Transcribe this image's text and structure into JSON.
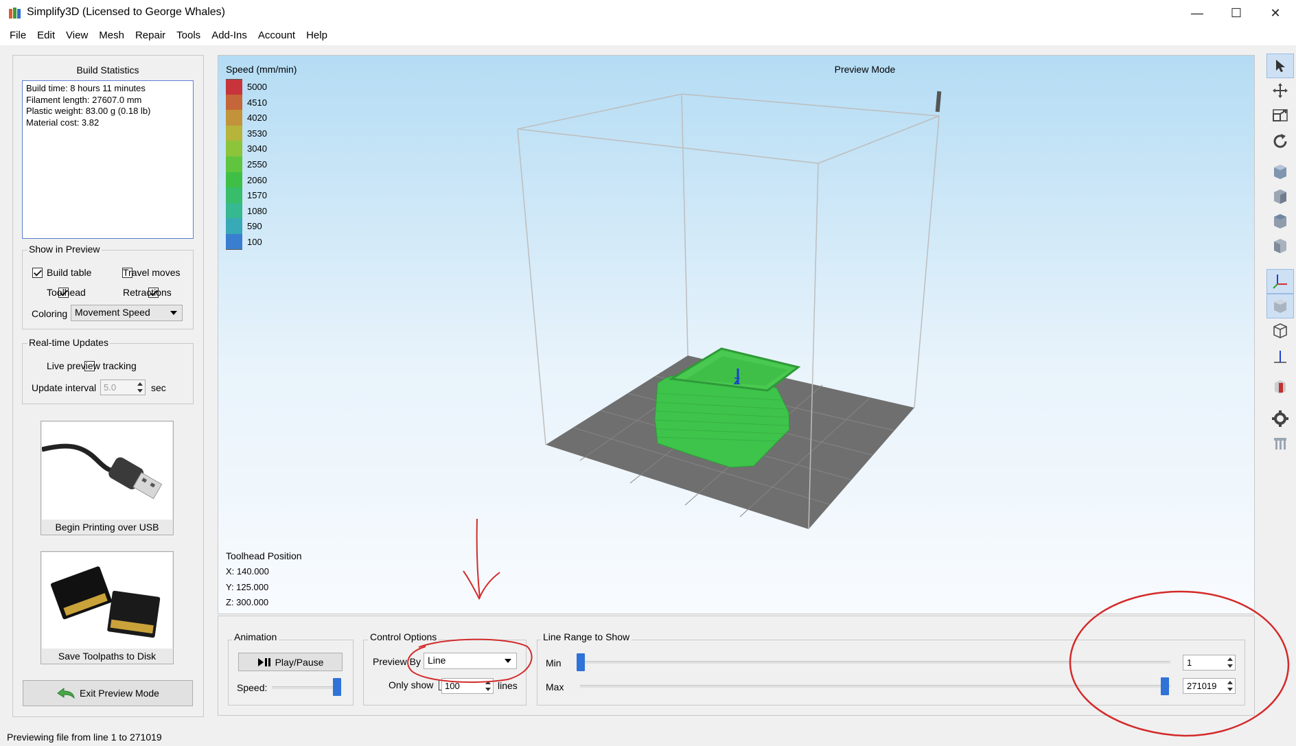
{
  "window": {
    "title": "Simplify3D (Licensed to George Whales)",
    "minimize_glyph": "—",
    "maximize_glyph": "☐",
    "close_glyph": "✕"
  },
  "menu": [
    "File",
    "Edit",
    "View",
    "Mesh",
    "Repair",
    "Tools",
    "Add-Ins",
    "Account",
    "Help"
  ],
  "build_statistics": {
    "title": "Build Statistics",
    "lines": [
      "Build time: 8 hours 11 minutes",
      "Filament length: 27607.0 mm",
      "Plastic weight: 83.00 g (0.18 lb)",
      "Material cost: 3.82"
    ]
  },
  "show_in_preview": {
    "title": "Show in Preview",
    "build_table": {
      "label": "Build table",
      "checked": true
    },
    "travel_moves": {
      "label": "Travel moves",
      "checked": false
    },
    "toolhead": {
      "label": "Toolhead",
      "checked": true
    },
    "retractions": {
      "label": "Retractions",
      "checked": true
    },
    "coloring_label": "Coloring",
    "coloring_value": "Movement Speed"
  },
  "realtime_updates": {
    "title": "Real-time Updates",
    "live_preview": {
      "label": "Live preview tracking",
      "checked": false
    },
    "update_interval_label": "Update interval",
    "update_interval_value": "5.0",
    "unit": "sec"
  },
  "actions": {
    "usb_label": "Begin Printing over USB",
    "disk_label": "Save Toolpaths to Disk",
    "exit_label": "Exit Preview Mode"
  },
  "viewport": {
    "mode_label": "Preview Mode",
    "legend_title": "Speed (mm/min)",
    "legend": [
      {
        "value": "5000",
        "color": "#c8343c"
      },
      {
        "value": "4510",
        "color": "#c4663a"
      },
      {
        "value": "4020",
        "color": "#c3933b"
      },
      {
        "value": "3530",
        "color": "#b6b43a"
      },
      {
        "value": "3040",
        "color": "#8cc43c"
      },
      {
        "value": "2550",
        "color": "#5fc53e"
      },
      {
        "value": "2060",
        "color": "#3fbf45"
      },
      {
        "value": "1570",
        "color": "#38bd6a"
      },
      {
        "value": "1080",
        "color": "#36b890"
      },
      {
        "value": "590",
        "color": "#38a9b6"
      },
      {
        "value": "100",
        "color": "#3a7ed0"
      }
    ],
    "toolhead_title": "Toolhead Position",
    "x": "X: 140.000",
    "y": "Y: 125.000",
    "z": "Z: 300.000",
    "axis_label": "Z"
  },
  "animation": {
    "title": "Animation",
    "play_label": "Play/Pause",
    "speed_label": "Speed:",
    "speed_level": 0.95
  },
  "control_options": {
    "title": "Control Options",
    "preview_by_label": "Preview By",
    "preview_by_value": "Line",
    "only_show_label": "Only show",
    "only_show_checked": false,
    "only_show_value": "100",
    "lines_label": "lines"
  },
  "line_range": {
    "title": "Line Range to Show",
    "min_label": "Min",
    "max_label": "Max",
    "min_value": "1",
    "max_value": "271019",
    "total_lines": 271019
  },
  "status": "Previewing file from line 1 to 271019",
  "colors": {
    "accent": "#2f72d8",
    "annotation": "#d42a2a",
    "model_green": "#3cc04a"
  }
}
